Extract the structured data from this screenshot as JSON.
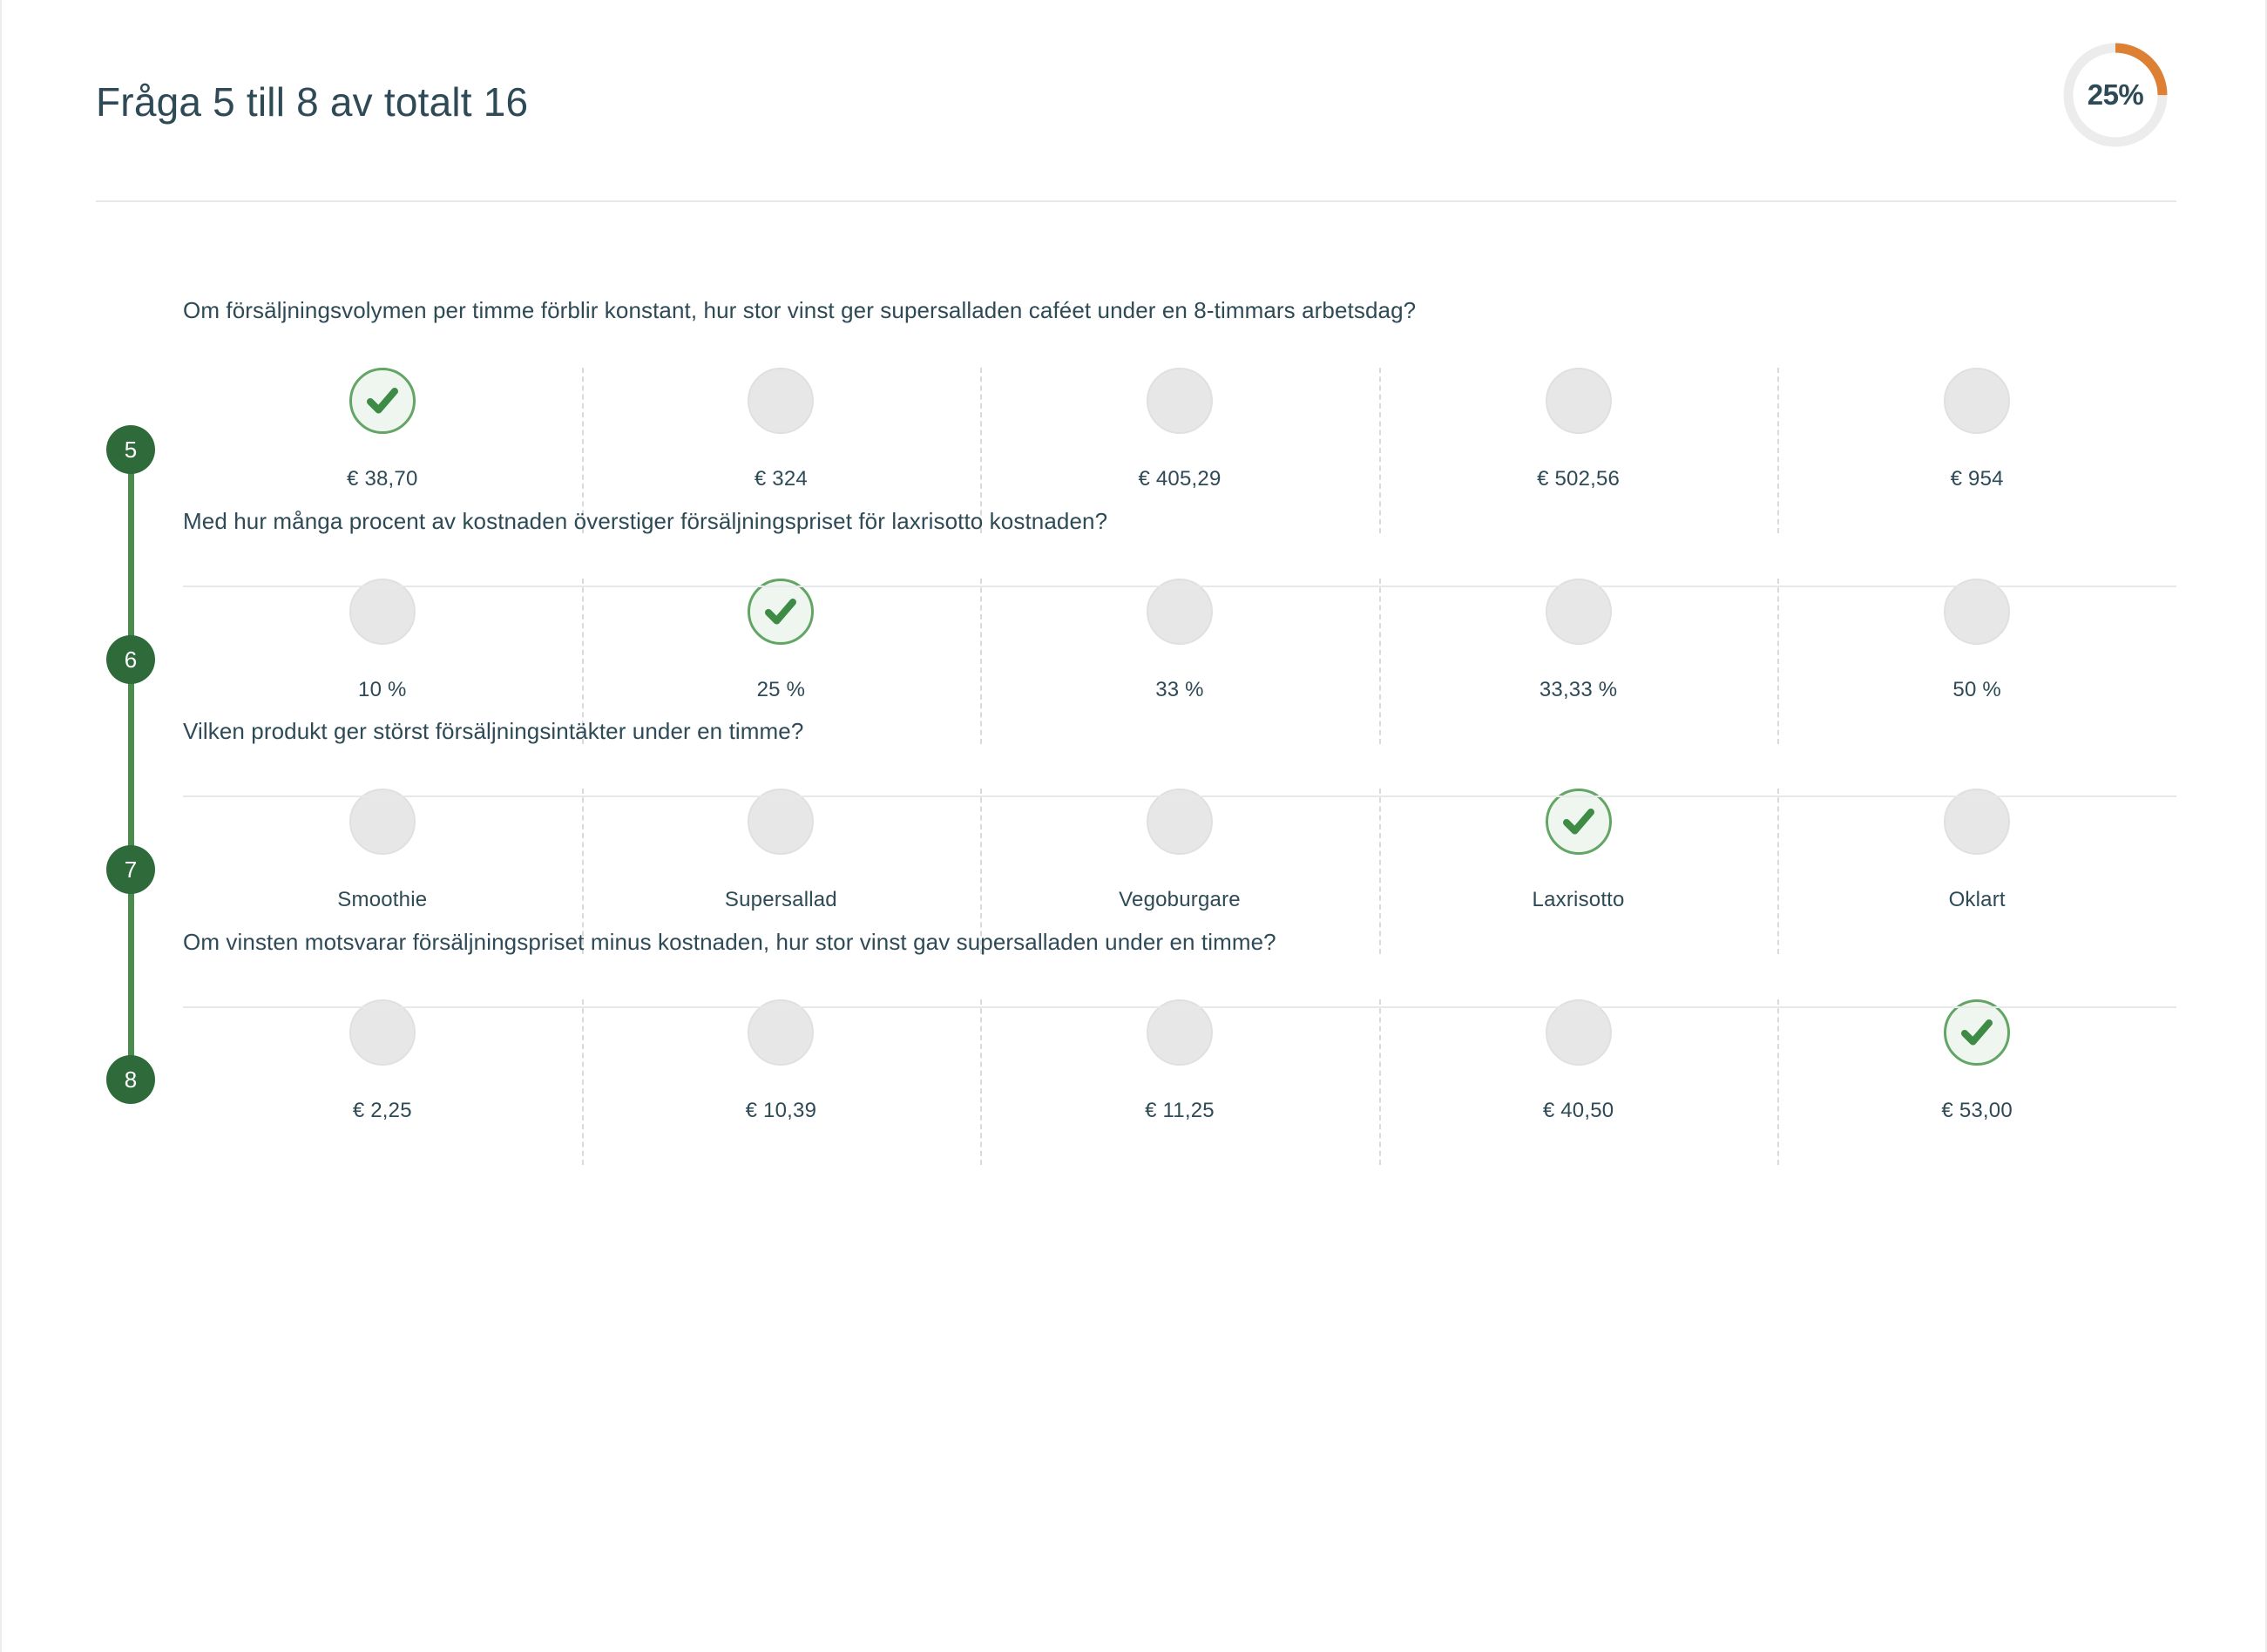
{
  "header": {
    "title": "Fråga 5 till 8 av totalt 16",
    "progress_percent_label": "25%",
    "progress_percent_value": 25,
    "progress_color": "#DD8034",
    "progress_track_color": "#ECECEC"
  },
  "theme": {
    "text_color": "#2E4A56",
    "node_green": "#2F6B3A",
    "line_green": "#4C8B4E",
    "check_green": "#3E8B45",
    "selected_fill": "#EFF6EF",
    "selected_border": "#62A564",
    "bubble_gray": "#E7E7E7",
    "divider_gray": "#E6E8E9"
  },
  "questions": [
    {
      "number": "5",
      "text": "Om försäljningsvolymen per timme förblir konstant, hur stor vinst ger supersalladen caféet under en 8-timmars arbetsdag?",
      "options": [
        {
          "label": "€ 38,70",
          "selected": true
        },
        {
          "label": "€ 324",
          "selected": false
        },
        {
          "label": "€ 405,29",
          "selected": false
        },
        {
          "label": "€ 502,56",
          "selected": false
        },
        {
          "label": "€ 954",
          "selected": false
        }
      ]
    },
    {
      "number": "6",
      "text": "Med hur många procent av kostnaden överstiger försäljningspriset för laxrisotto kostnaden?",
      "options": [
        {
          "label": "10 %",
          "selected": false
        },
        {
          "label": "25 %",
          "selected": true
        },
        {
          "label": "33 %",
          "selected": false
        },
        {
          "label": "33,33 %",
          "selected": false
        },
        {
          "label": "50 %",
          "selected": false
        }
      ]
    },
    {
      "number": "7",
      "text": "Vilken produkt ger störst försäljningsintäkter under en timme?",
      "options": [
        {
          "label": "Smoothie",
          "selected": false
        },
        {
          "label": "Supersallad",
          "selected": false
        },
        {
          "label": "Vegoburgare",
          "selected": false
        },
        {
          "label": "Laxrisotto",
          "selected": true
        },
        {
          "label": "Oklart",
          "selected": false
        }
      ]
    },
    {
      "number": "8",
      "text": "Om vinsten motsvarar försäljningspriset minus kostnaden, hur stor vinst gav supersalladen under en timme?",
      "options": [
        {
          "label": "€ 2,25",
          "selected": false
        },
        {
          "label": "€ 10,39",
          "selected": false
        },
        {
          "label": "€ 11,25",
          "selected": false
        },
        {
          "label": "€ 40,50",
          "selected": false
        },
        {
          "label": "€ 53,00",
          "selected": true
        }
      ]
    }
  ]
}
